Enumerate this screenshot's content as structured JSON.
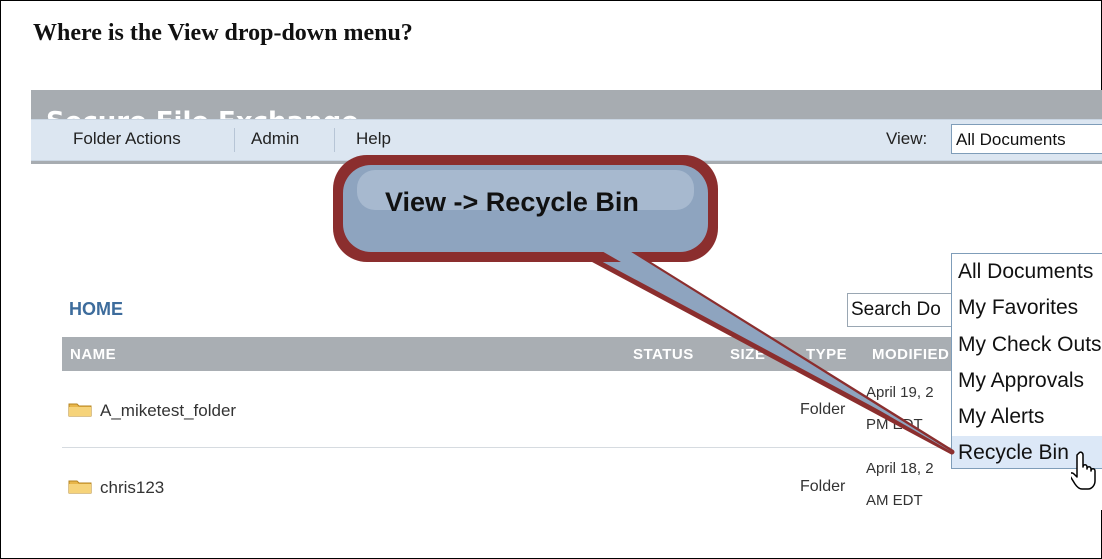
{
  "question": "Where is the View drop-down menu?",
  "app": {
    "title": "Secure File Exchange"
  },
  "toolbar": {
    "items": [
      "Folder Actions",
      "Admin",
      "Help"
    ],
    "view_label": "View:",
    "view_value": "All Documents"
  },
  "breadcrumb": "HOME",
  "search": {
    "text": "Search Do"
  },
  "grid": {
    "headers": [
      "NAME",
      "STATUS",
      "SIZE",
      "TYPE",
      "MODIFIED"
    ],
    "rows": [
      {
        "name": "A_miketest_folder",
        "type": "Folder",
        "date_line1": "April 19, 2",
        "date_line2": "PM EDT"
      },
      {
        "name": "chris123",
        "type": "Folder",
        "date_line1": "April 18, 2",
        "date_line2": "AM EDT"
      }
    ]
  },
  "dropdown": {
    "options": [
      "All Documents",
      "My Favorites",
      "My Check Outs",
      "My Approvals",
      "My Alerts",
      "Recycle Bin"
    ],
    "highlighted": "Recycle Bin",
    "highlight_color": "#dce8f7"
  },
  "callout": {
    "text": "View -> Recycle Bin",
    "border_color": "#8b2e2e",
    "fill_color": "#8ea4bf"
  },
  "icons": {
    "folder": "folder-icon",
    "cursor": "hand-pointer-icon"
  }
}
